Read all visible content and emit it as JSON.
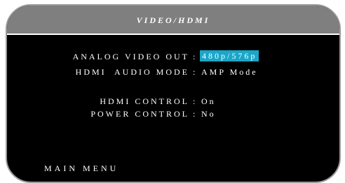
{
  "screen": {
    "title": "VIDEO/HDMI"
  },
  "settings": [
    {
      "label": "ANALOG VIDEO OUT",
      "value": "480p/576p"
    },
    {
      "label": "HDMI  AUDIO MODE",
      "value": "AMP Mode"
    },
    {
      "label": "HDMI CONTROL",
      "value": "On"
    },
    {
      "label": "POWER CONTROL",
      "value": "No"
    }
  ],
  "separator": ":",
  "footer": {
    "main_menu_label": "MAIN MENU"
  },
  "colors": {
    "background": "#000000",
    "title_bar": "#7f7f7f",
    "highlight": "#1aa6c8",
    "text": "#ffffff"
  }
}
